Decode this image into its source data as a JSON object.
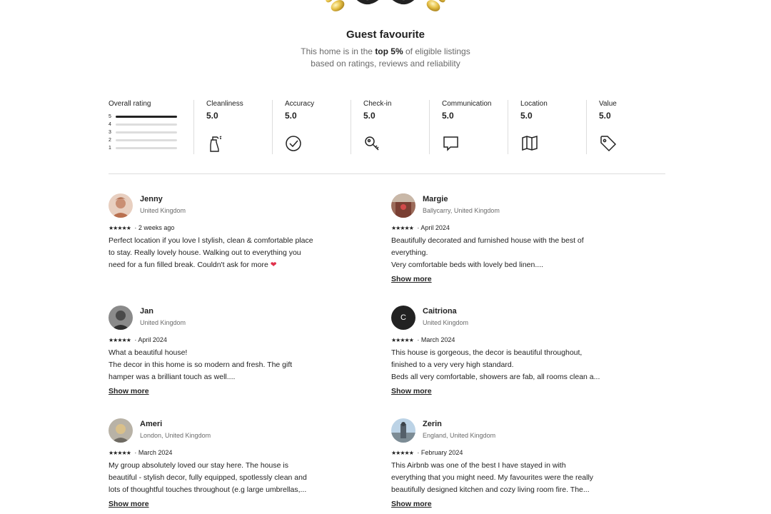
{
  "guest_favourite": {
    "title": "Guest favourite",
    "subtitle_pre": "This home is in the ",
    "subtitle_bold": "top 5%",
    "subtitle_post": " of eligible listings",
    "subtitle_line2": "based on ratings, reviews and reliability"
  },
  "ratings": {
    "overall_label": "Overall rating",
    "distribution": [
      {
        "star": "5",
        "fraction": 1.0
      },
      {
        "star": "4",
        "fraction": 0
      },
      {
        "star": "3",
        "fraction": 0
      },
      {
        "star": "2",
        "fraction": 0
      },
      {
        "star": "1",
        "fraction": 0
      }
    ],
    "categories": [
      {
        "label": "Cleanliness",
        "value": "5.0",
        "icon": "spray-bottle-icon"
      },
      {
        "label": "Accuracy",
        "value": "5.0",
        "icon": "checkmark-circle-icon"
      },
      {
        "label": "Check-in",
        "value": "5.0",
        "icon": "key-icon"
      },
      {
        "label": "Communication",
        "value": "5.0",
        "icon": "chat-bubble-icon"
      },
      {
        "label": "Location",
        "value": "5.0",
        "icon": "map-icon"
      },
      {
        "label": "Value",
        "value": "5.0",
        "icon": "price-tag-icon"
      }
    ]
  },
  "reviews": [
    {
      "name": "Jenny",
      "location": "United Kingdom",
      "stars": "★★★★★",
      "date": "2 weeks ago",
      "lines": [
        "Perfect location if you love l stylish, clean & comfortable place",
        "to stay. Really lovely house. Walking out to everything you",
        "need for a fun filled break. Couldn't ask for more"
      ],
      "heart": "❤"
    },
    {
      "name": "Margie",
      "location": "Ballycarry, United Kingdom",
      "stars": "★★★★★",
      "date": "April 2024",
      "lines": [
        "Beautifully decorated and furnished house with the best of",
        "everything.",
        "Very comfortable beds with lovely bed linen...."
      ],
      "show_more": "Show more"
    },
    {
      "name": "Jan",
      "location": "United Kingdom",
      "stars": "★★★★★",
      "date": "April 2024",
      "lines": [
        "What a beautiful house!",
        "The decor in this home is so modern and fresh. The gift",
        "hamper was a brilliant touch as well...."
      ],
      "show_more": "Show more"
    },
    {
      "name": "Caitriona",
      "initial": "C",
      "location": "United Kingdom",
      "stars": "★★★★★",
      "date": "March 2024",
      "lines": [
        "This house is gorgeous, the decor is beautiful throughout,",
        "finished to a very very high standard.",
        "Beds all very comfortable, showers are fab, all rooms clean a..."
      ],
      "show_more": "Show more"
    },
    {
      "name": "Ameri",
      "location": "London, United Kingdom",
      "stars": "★★★★★",
      "date": "March 2024",
      "lines": [
        "My group absolutely loved our stay here. The house is",
        "beautiful - stylish decor, fully equipped, spotlessly clean and",
        "lots of thoughtful touches throughout (e.g large umbrellas,..."
      ],
      "show_more": "Show more"
    },
    {
      "name": "Zerin",
      "location": "England, United Kingdom",
      "stars": "★★★★★",
      "date": "February 2024",
      "lines": [
        "This Airbnb was one of the best I have stayed in with",
        "everything that you might need. My favourites were the really",
        "beautifully designed kitchen and cozy living room fire. The..."
      ],
      "show_more": "Show more"
    }
  ]
}
